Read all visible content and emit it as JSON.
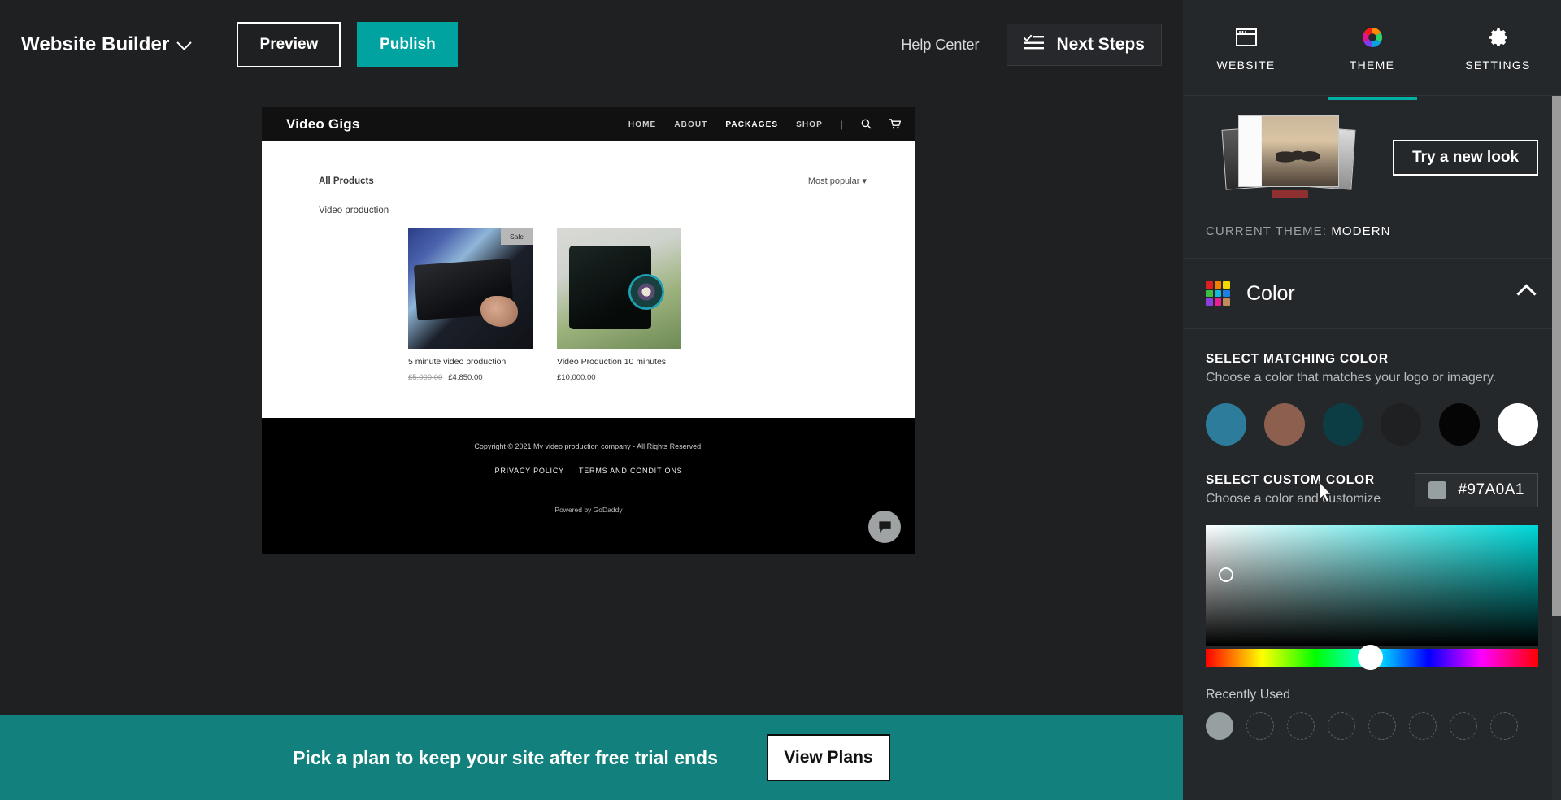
{
  "topbar": {
    "brand": "Website Builder",
    "brand_chevron_icon": "chevron-down-icon",
    "preview_label": "Preview",
    "publish_label": "Publish",
    "help_center_label": "Help Center",
    "next_steps_label": "Next Steps",
    "next_steps_icon": "checklist-icon",
    "publish_color": "#00a3a0"
  },
  "site_preview": {
    "logo": "Video Gigs",
    "nav": [
      {
        "label": "HOME",
        "active": false
      },
      {
        "label": "ABOUT",
        "active": false
      },
      {
        "label": "PACKAGES",
        "active": true
      },
      {
        "label": "SHOP",
        "active": false
      }
    ],
    "search_icon": "search-icon",
    "cart_icon": "cart-icon",
    "all_products_label": "All Products",
    "sort_label": "Most popular",
    "sort_caret_icon": "caret-down-icon",
    "category_label": "Video production",
    "products": [
      {
        "title": "5 minute video production",
        "old_price": "£5,000.00",
        "price": "£4,850.00",
        "badge": "Sale"
      },
      {
        "title": "Video Production 10 minutes",
        "old_price": "",
        "price": "£10,000.00",
        "badge": ""
      }
    ],
    "footer": {
      "copyright": "Copyright © 2021 My video production company - All Rights Reserved.",
      "links": [
        "PRIVACY POLICY",
        "TERMS AND CONDITIONS"
      ],
      "powered_by": "Powered by GoDaddy",
      "chat_icon": "chat-bubble-icon"
    }
  },
  "banner": {
    "text": "Pick a plan to keep your site after free trial ends",
    "button_label": "View Plans",
    "background": "#12807c"
  },
  "sidebar": {
    "tabs": [
      {
        "label": "WEBSITE",
        "icon": "browser-window-icon",
        "active": false
      },
      {
        "label": "THEME",
        "icon": "color-wheel-icon",
        "active": true
      },
      {
        "label": "SETTINGS",
        "icon": "gear-icon",
        "active": false
      }
    ],
    "active_indicator_color": "#00b0a6",
    "theme": {
      "thumbnail_icon": "theme-preview-thumbnail",
      "try_new_look_label": "Try a new look",
      "current_theme_prefix": "CURRENT THEME:",
      "current_theme_name": "MODERN"
    },
    "color_section": {
      "icon": "color-palette-grid-icon",
      "title": "Color",
      "collapse_icon": "chevron-up-icon",
      "matching": {
        "title": "SELECT MATCHING COLOR",
        "subtitle": "Choose a color that matches your logo or imagery.",
        "swatches": [
          "#2d7c9b",
          "#8c5f4e",
          "#0d3d44",
          "#1e2022",
          "#050505",
          "#ffffff"
        ]
      },
      "custom": {
        "title": "SELECT CUSTOM COLOR",
        "subtitle": "Choose a color and customize",
        "hex": "#97A0A1",
        "chip_color": "#97a0a1"
      },
      "picker": {
        "gradient_top_right": "#00d8d8",
        "knob_icon": "picker-knob-icon",
        "hue_knob_icon": "hue-slider-knob-icon"
      },
      "recently_used": {
        "title": "Recently Used",
        "swatches": [
          "#97a0a1",
          "",
          "",
          "",
          "",
          "",
          "",
          ""
        ]
      }
    },
    "scrollbar_icon": "vertical-scrollbar"
  },
  "cursor": {
    "icon": "mouse-pointer-icon"
  }
}
